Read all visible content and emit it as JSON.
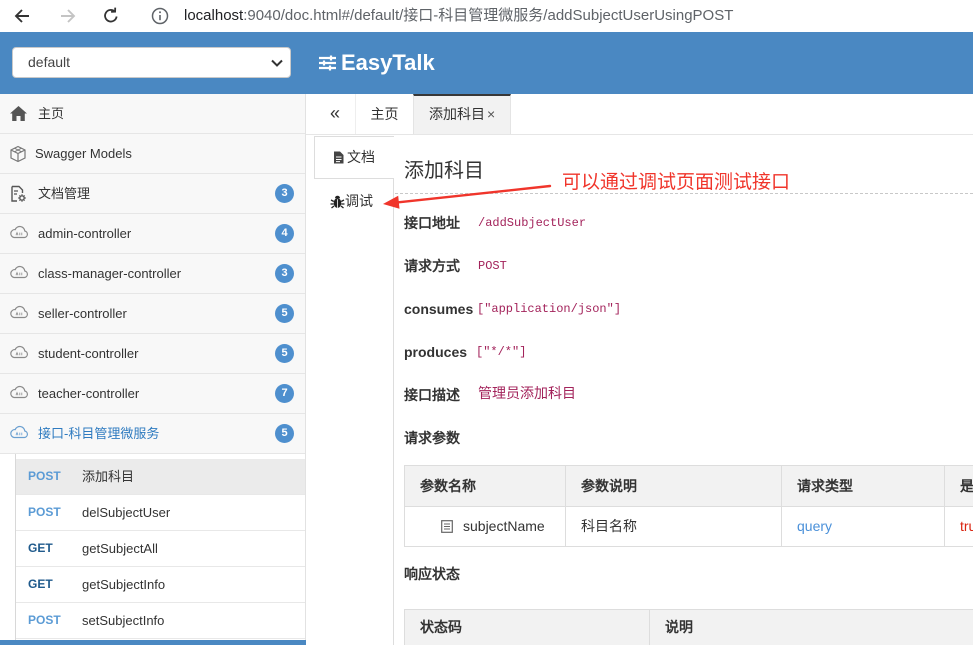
{
  "browser": {
    "url_host": "localhost",
    "url_path": ":9040/doc.html#/default/接口-科目管理微服务/addSubjectUserUsingPOST",
    "icons": [
      "back-arrow-icon",
      "forward-arrow-icon",
      "reload-icon",
      "info-icon"
    ]
  },
  "header": {
    "group_select": "default",
    "logo_text": "EasyTalk",
    "logo_icon": "sliders-menu-icon",
    "bg_color": "#4a88c2"
  },
  "sidebar": {
    "items": [
      {
        "label": "主页",
        "icon": "home-icon"
      },
      {
        "label": "Swagger Models",
        "icon": "cube-icon"
      },
      {
        "label": "文档管理",
        "icon": "doc-settings-icon",
        "count": "3"
      },
      {
        "label": "admin-controller",
        "icon": "api-cloud-icon",
        "count": "4"
      },
      {
        "label": "class-manager-controller",
        "icon": "api-cloud-icon",
        "count": "3"
      },
      {
        "label": "seller-controller",
        "icon": "api-cloud-icon",
        "count": "5"
      },
      {
        "label": "student-controller",
        "icon": "api-cloud-icon",
        "count": "5"
      },
      {
        "label": "teacher-controller",
        "icon": "api-cloud-icon",
        "count": "7"
      },
      {
        "label": "接口-科目管理微服务",
        "icon": "api-cloud-icon",
        "count": "5",
        "active": true
      }
    ],
    "operations": [
      {
        "method": "POST",
        "name": "添加科目",
        "selected": true
      },
      {
        "method": "POST",
        "name": "delSubjectUser"
      },
      {
        "method": "GET",
        "name": "getSubjectAll"
      },
      {
        "method": "GET",
        "name": "getSubjectInfo"
      },
      {
        "method": "POST",
        "name": "setSubjectInfo"
      }
    ],
    "colors": {
      "post": "#5b9bd5",
      "get": "#1f5a8c",
      "badge": "#4e8fce",
      "active_group": "#2f7bc0"
    }
  },
  "tabs": {
    "collapse_symbol": "«",
    "items": [
      {
        "label": "主页"
      },
      {
        "label": "添加科目",
        "close_symbol": "×",
        "active": true
      }
    ]
  },
  "doc_nav": {
    "doc_label": "文档",
    "doc_icon": "file-icon",
    "debug_label": "调试",
    "debug_icon": "bug-icon"
  },
  "annotation": {
    "text": "可以通过调试页面测试接口",
    "color": "#f0352b"
  },
  "api": {
    "title": "添加科目",
    "fields": [
      {
        "label": "接口地址",
        "value": "/addSubjectUser"
      },
      {
        "label": "请求方式",
        "value": "POST"
      },
      {
        "label": "consumes",
        "value": "[\"application/json\"]"
      },
      {
        "label": "produces",
        "value": "[\"*/*\"]"
      },
      {
        "label": "接口描述",
        "value": "管理员添加科目"
      }
    ],
    "request_params_label": "请求参数",
    "params_table": {
      "headers": [
        "参数名称",
        "参数说明",
        "请求类型",
        "是"
      ],
      "rows": [
        {
          "name": "subjectName",
          "description": "科目名称",
          "in": "query",
          "required": "tru"
        }
      ]
    },
    "response_status_label": "响应状态",
    "response_table": {
      "headers": [
        "状态码",
        "说明"
      ]
    }
  }
}
